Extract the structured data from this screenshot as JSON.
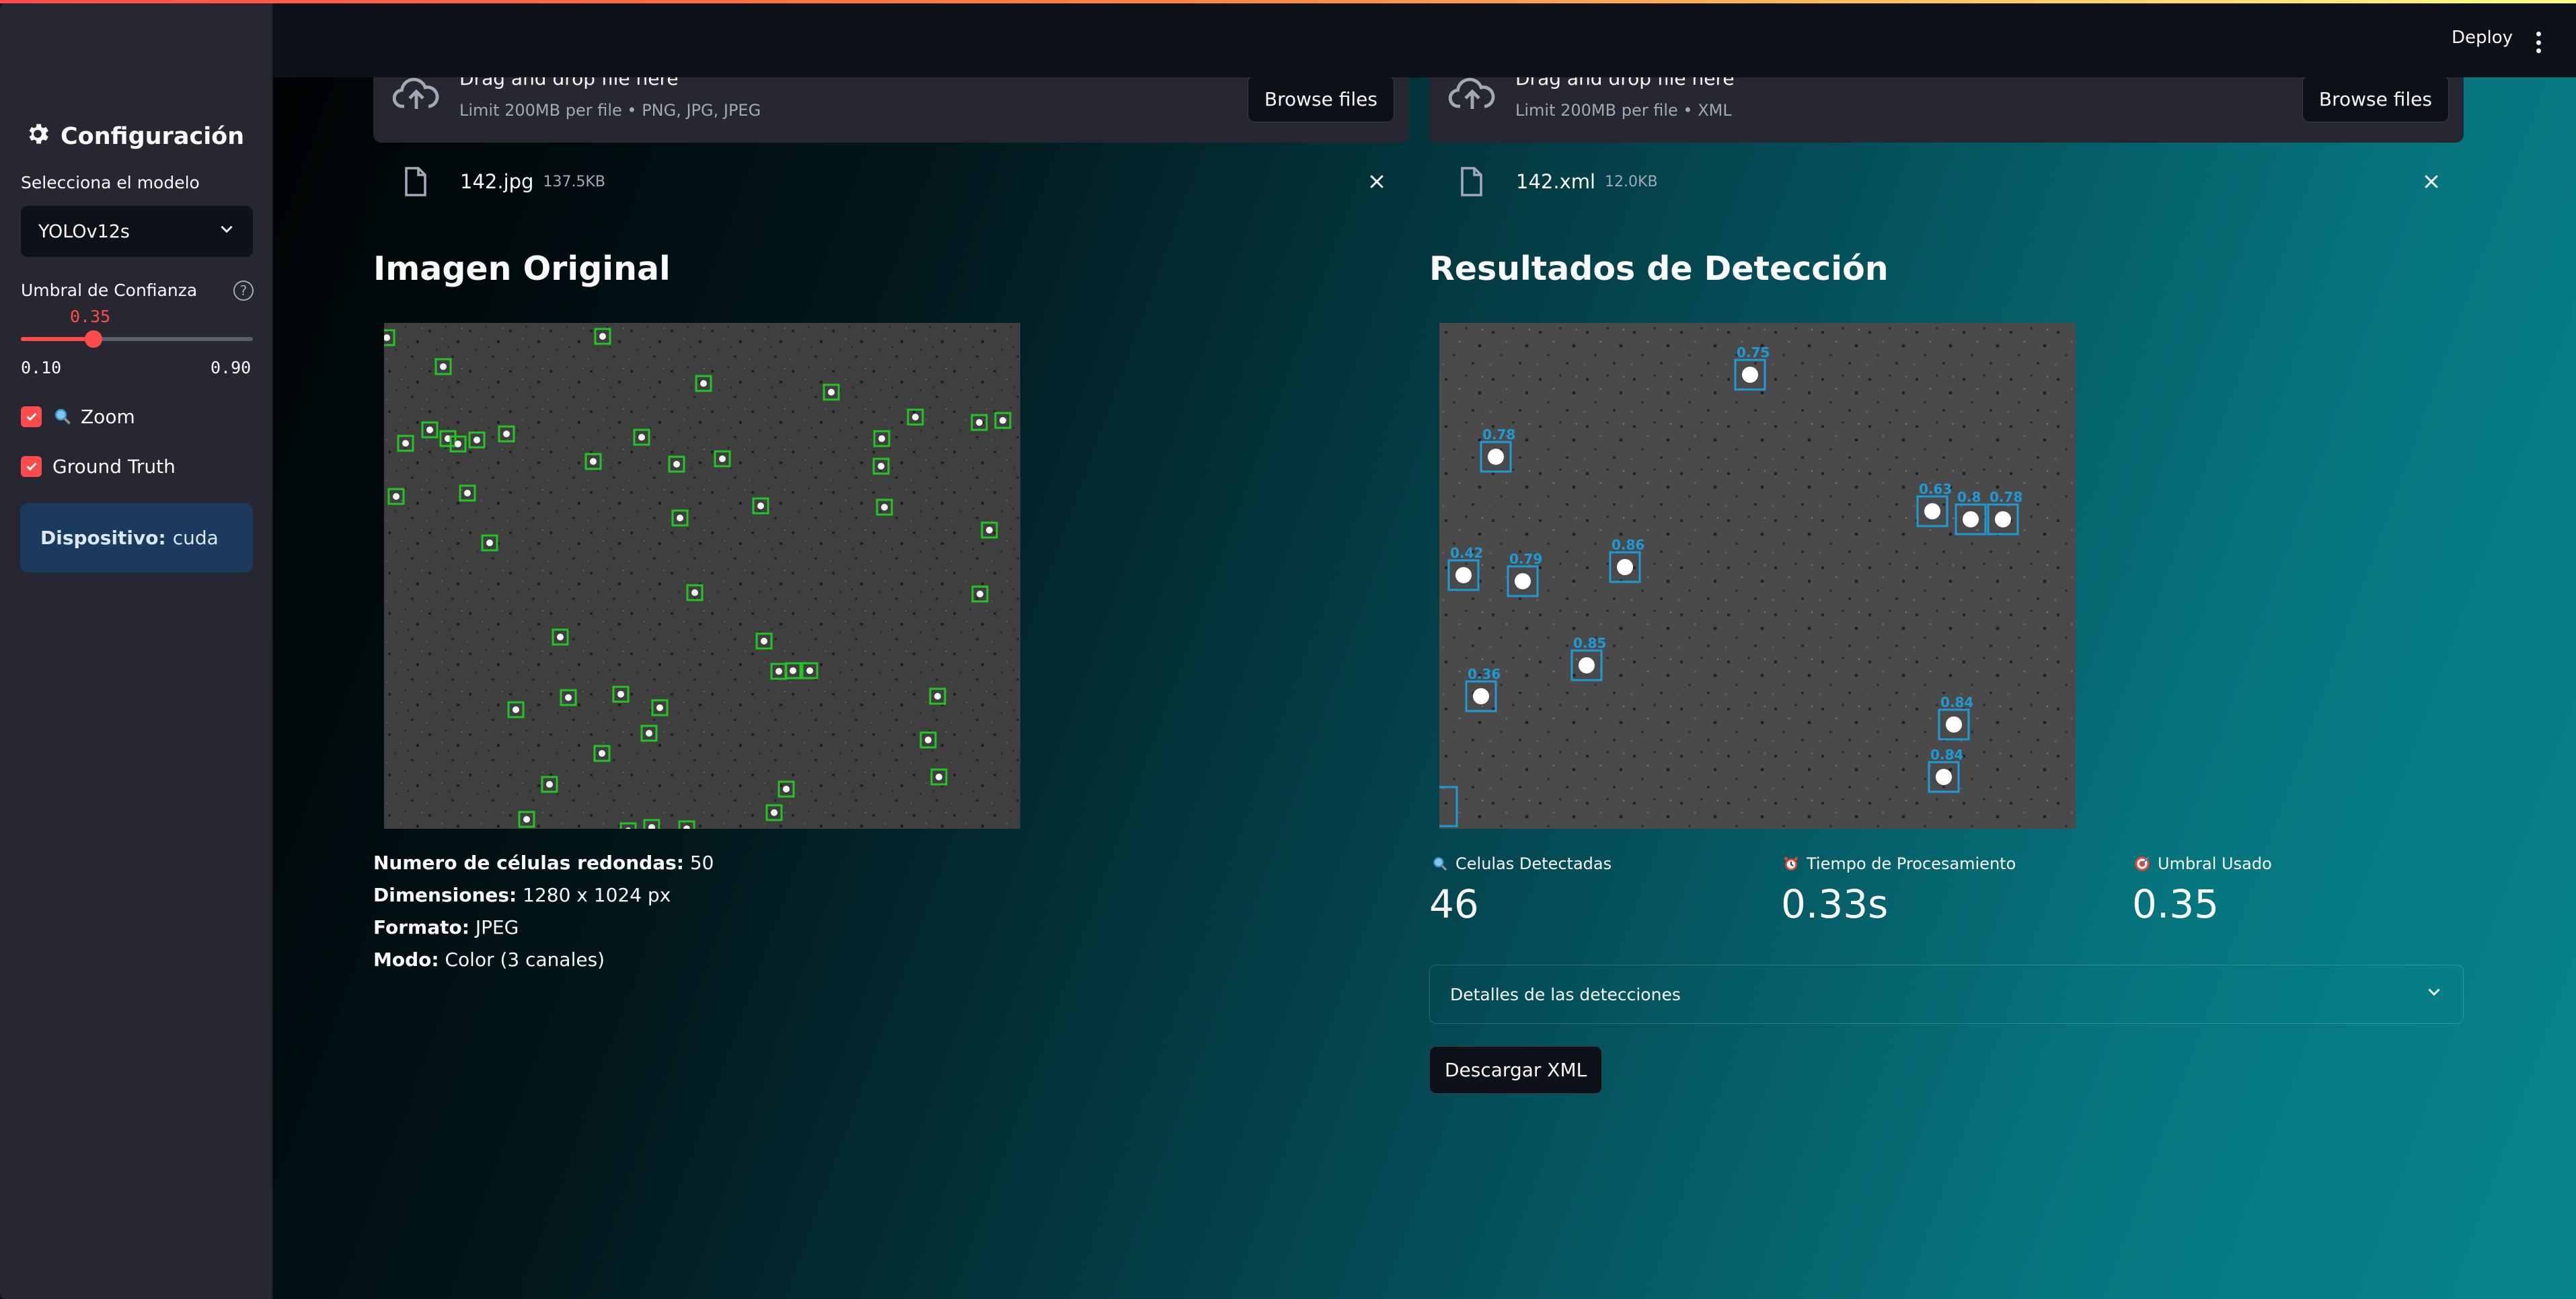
{
  "header": {
    "deploy_label": "Deploy",
    "menu_icon": "kebab-menu-icon"
  },
  "sidebar": {
    "title": "Configuración",
    "title_icon": "gear-icon",
    "model_label": "Selecciona el modelo",
    "model_selected": "YOLOv12s",
    "threshold_label": "Umbral de Confianza",
    "threshold_value": "0.35",
    "threshold_fraction": 0.3125,
    "threshold_min": "0.10",
    "threshold_max": "0.90",
    "zoom_label": "Zoom",
    "zoom_checked": true,
    "ground_truth_label": "Ground Truth",
    "ground_truth_checked": true,
    "device_key": "Dispositivo:",
    "device_value": "cuda"
  },
  "uploaders": [
    {
      "drop_text": "Drag and drop file here",
      "limit_text": "Limit 200MB per file • PNG, JPG, JPEG",
      "browse_label": "Browse files",
      "file_name": "142.jpg",
      "file_size": "137.5KB"
    },
    {
      "drop_text": "Drag and drop file here",
      "limit_text": "Limit 200MB per file • XML",
      "browse_label": "Browse files",
      "file_name": "142.xml",
      "file_size": "12.0KB"
    }
  ],
  "original": {
    "title": "Imagen Original",
    "info": [
      {
        "key": "Numero de células redondas:",
        "value": "50"
      },
      {
        "key": "Dimensiones:",
        "value": "1280 x 1024 px"
      },
      {
        "key": "Formato:",
        "value": "JPEG"
      },
      {
        "key": "Modo:",
        "value": "Color (3 canales)"
      }
    ]
  },
  "results": {
    "title": "Resultados de Detección",
    "detection_labels": [
      "0.75",
      "0.78",
      "0.63",
      "0.8",
      "0.78",
      "0.42",
      "0.79",
      "0.86",
      "0.36",
      "0.85",
      "0.84",
      "0.84"
    ],
    "metrics": [
      {
        "label": "Celulas Detectadas",
        "value": "46",
        "icon": "magnifier-icon"
      },
      {
        "label": "Tiempo de Procesamiento",
        "value": "0.33s",
        "icon": "alarm-clock-icon"
      },
      {
        "label": "Umbral Usado",
        "value": "0.35",
        "icon": "target-icon"
      }
    ],
    "expander_label": "Detalles de las detecciones",
    "download_label": "Descargar XML"
  },
  "colors": {
    "accent": "#ff4b4b",
    "ground_truth_box": "#22c522",
    "detection_box": "#1e9ad6"
  }
}
